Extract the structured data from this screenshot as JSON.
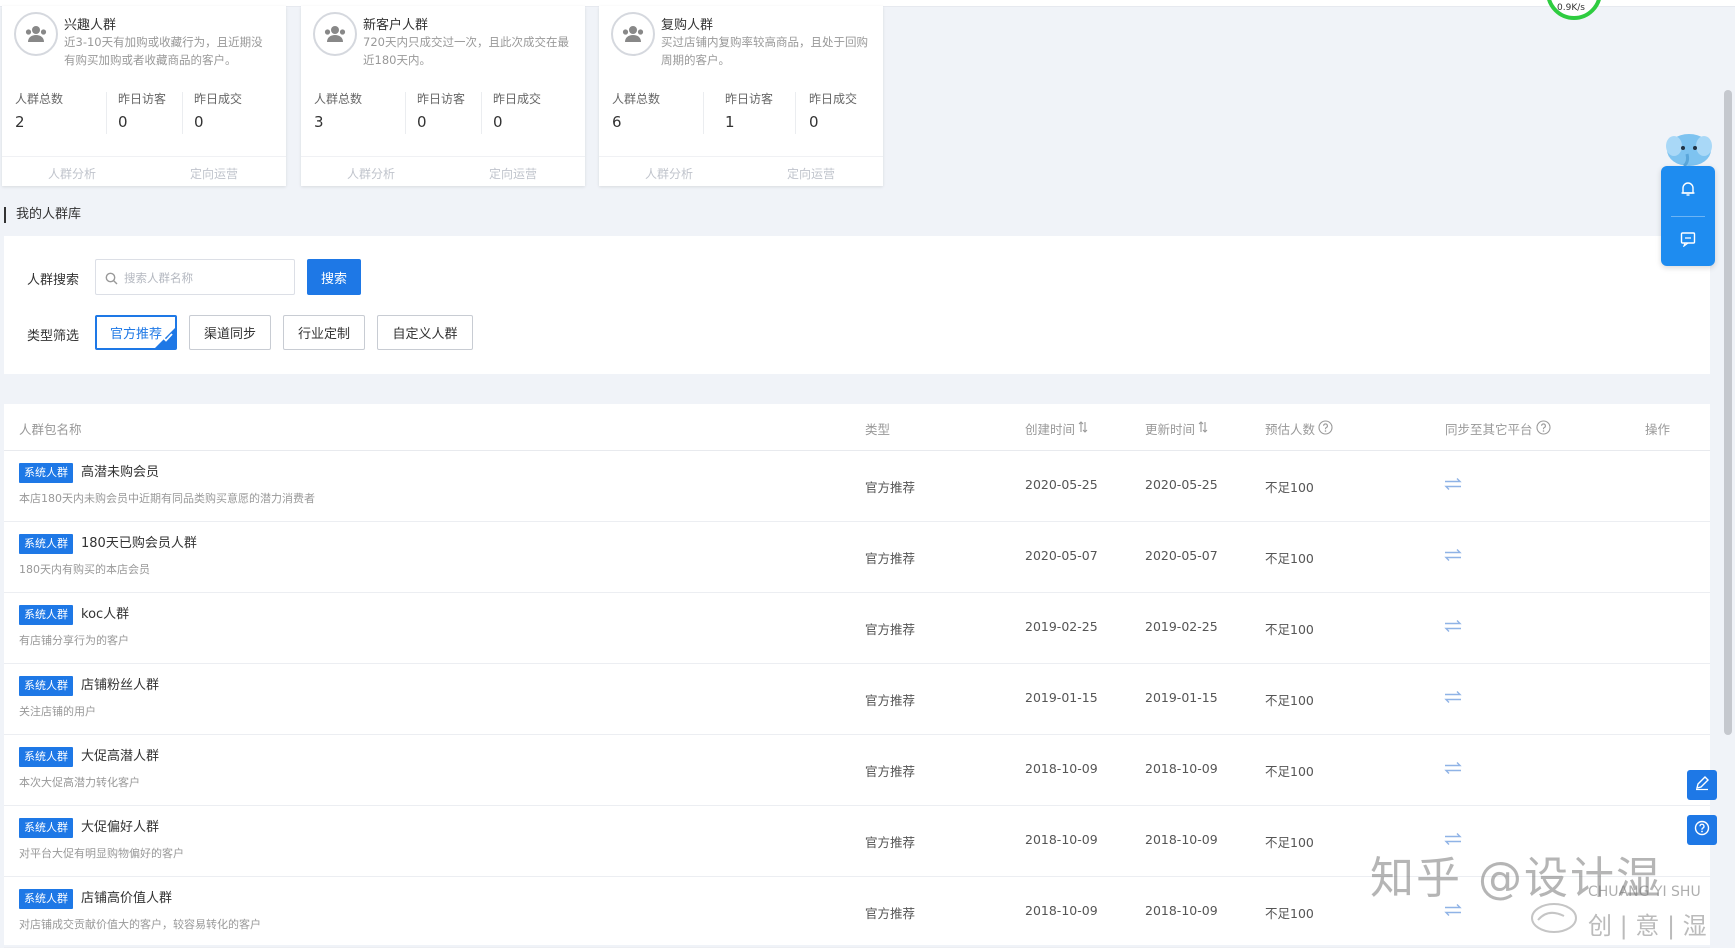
{
  "cards": [
    {
      "title": "兴趣人群",
      "desc": "近3-10天有加购或收藏行为，且近期没有购买加购或者收藏商品的客户。",
      "stats": [
        {
          "label": "人群总数",
          "value": "2"
        },
        {
          "label": "昨日访客",
          "value": "0"
        },
        {
          "label": "昨日成交",
          "value": "0"
        }
      ],
      "actions": [
        "人群分析",
        "定向运营"
      ]
    },
    {
      "title": "新客户人群",
      "desc": "720天内只成交过一次，且此次成交在最近180天内。",
      "stats": [
        {
          "label": "人群总数",
          "value": "3"
        },
        {
          "label": "昨日访客",
          "value": "0"
        },
        {
          "label": "昨日成交",
          "value": "0"
        }
      ],
      "actions": [
        "人群分析",
        "定向运营"
      ]
    },
    {
      "title": "复购人群",
      "desc": "买过店铺内复购率较高商品，且处于回购周期的客户。",
      "stats": [
        {
          "label": "人群总数",
          "value": "6"
        },
        {
          "label": "昨日访客",
          "value": "1"
        },
        {
          "label": "昨日成交",
          "value": "0"
        }
      ],
      "actions": [
        "人群分析",
        "定向运营"
      ]
    }
  ],
  "section_title": "我的人群库",
  "filter": {
    "search_label": "人群搜索",
    "search_placeholder": "搜索人群名称",
    "search_value": "",
    "search_button": "搜索",
    "type_label": "类型筛选",
    "chips": [
      {
        "label": "官方推荐",
        "active": true
      },
      {
        "label": "渠道同步",
        "active": false
      },
      {
        "label": "行业定制",
        "active": false
      },
      {
        "label": "自定义人群",
        "active": false
      }
    ]
  },
  "table": {
    "headers": {
      "name": "人群包名称",
      "type": "类型",
      "created": "创建时间",
      "updated": "更新时间",
      "estimate": "预估人数",
      "sync": "同步至其它平台",
      "ops": "操作"
    },
    "badge": "系统人群",
    "rows": [
      {
        "name": "高潜未购会员",
        "desc": "本店180天内未购会员中近期有同品类购买意愿的潜力消费者",
        "type": "官方推荐",
        "created": "2020-05-25",
        "updated": "2020-05-25",
        "estimate": "不足100"
      },
      {
        "name": "180天已购会员人群",
        "desc": "180天内有购买的本店会员",
        "type": "官方推荐",
        "created": "2020-05-07",
        "updated": "2020-05-07",
        "estimate": "不足100"
      },
      {
        "name": "koc人群",
        "desc": "有店铺分享行为的客户",
        "type": "官方推荐",
        "created": "2019-02-25",
        "updated": "2019-02-25",
        "estimate": "不足100"
      },
      {
        "name": "店铺粉丝人群",
        "desc": "关注店铺的用户",
        "type": "官方推荐",
        "created": "2019-01-15",
        "updated": "2019-01-15",
        "estimate": "不足100"
      },
      {
        "name": "大促高潜人群",
        "desc": "本次大促高潜力转化客户",
        "type": "官方推荐",
        "created": "2018-10-09",
        "updated": "2018-10-09",
        "estimate": "不足100"
      },
      {
        "name": "大促偏好人群",
        "desc": "对平台大促有明显购物偏好的客户",
        "type": "官方推荐",
        "created": "2018-10-09",
        "updated": "2018-10-09",
        "estimate": "不足100"
      },
      {
        "name": "店铺高价值人群",
        "desc": "对店铺成交贡献价值大的客户，较容易转化的客户",
        "type": "官方推荐",
        "created": "2018-10-09",
        "updated": "2018-10-09",
        "estimate": "不足100"
      }
    ]
  },
  "widgets": {
    "speed": "0.9K/s",
    "watermark": "知乎 @设计湿",
    "watermark_logo": [
      "CHUANG YI SHU",
      "创 | 意 | 湿"
    ]
  },
  "colors": {
    "accent": "#1e78e6",
    "float": "#1e8cf0",
    "speed_ring": "#2ecc40"
  },
  "icons": [
    "crowd-icon",
    "search-icon",
    "check-icon",
    "sort-icon",
    "help-icon",
    "sync-icon",
    "bell-icon",
    "chat-icon",
    "edit-icon",
    "question-icon"
  ]
}
